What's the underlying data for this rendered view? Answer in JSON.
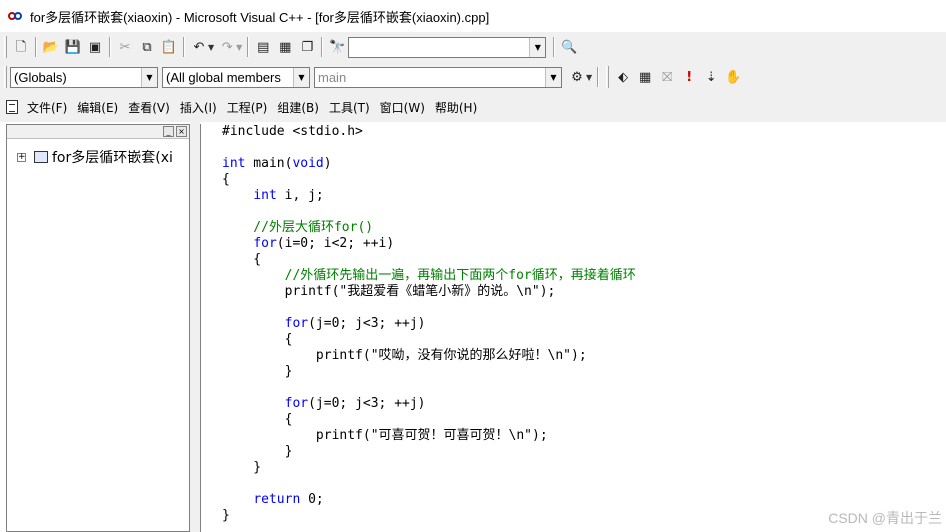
{
  "window": {
    "title": "for多层循环嵌套(xiaoxin) - Microsoft Visual C++ - [for多层循环嵌套(xiaoxin).cpp]"
  },
  "toolbar": {
    "find_value": "",
    "icons": [
      "new-file-icon",
      "open-folder-icon",
      "save-icon",
      "save-all-icon",
      "cut-icon",
      "copy-icon",
      "paste-icon",
      "undo-icon",
      "redo-icon",
      "workspace-icon",
      "output-icon",
      "window-list-icon",
      "find-in-files-icon",
      "find-icon"
    ]
  },
  "wizardbar": {
    "class_combo": "(Globals)",
    "filter_combo": "(All global members",
    "member_combo": "main",
    "build_icons": [
      "compile-icon",
      "build-icon",
      "stop-build-icon",
      "execute-icon",
      "go-icon",
      "breakpoint-icon"
    ]
  },
  "menu": {
    "items": [
      "文件(F)",
      "编辑(E)",
      "查看(V)",
      "插入(I)",
      "工程(P)",
      "组建(B)",
      "工具(T)",
      "窗口(W)",
      "帮助(H)"
    ]
  },
  "workspace": {
    "tree_item": "for多层循环嵌套(xi"
  },
  "editor": {
    "lines": [
      [
        {
          "t": "#include <stdio.h>",
          "c": ""
        }
      ],
      [],
      [
        {
          "t": "int",
          "c": "kw"
        },
        {
          "t": " main(",
          "c": ""
        },
        {
          "t": "void",
          "c": "kw"
        },
        {
          "t": ")",
          "c": ""
        }
      ],
      [
        {
          "t": "{",
          "c": ""
        }
      ],
      [
        {
          "t": "    ",
          "c": ""
        },
        {
          "t": "int",
          "c": "kw"
        },
        {
          "t": " i, j;",
          "c": ""
        }
      ],
      [],
      [
        {
          "t": "    //外层大循环for()",
          "c": "cm"
        }
      ],
      [
        {
          "t": "    ",
          "c": ""
        },
        {
          "t": "for",
          "c": "kw"
        },
        {
          "t": "(i=0; i<2; ++i)",
          "c": ""
        }
      ],
      [
        {
          "t": "    {",
          "c": ""
        }
      ],
      [
        {
          "t": "        //外循环先输出一遍，再输出下面两个for循环，再接着循环",
          "c": "cm"
        }
      ],
      [
        {
          "t": "        printf(\"我超爱看《蜡笔小新》的说。\\n\");",
          "c": ""
        }
      ],
      [],
      [
        {
          "t": "        ",
          "c": ""
        },
        {
          "t": "for",
          "c": "kw"
        },
        {
          "t": "(j=0; j<3; ++j)",
          "c": ""
        }
      ],
      [
        {
          "t": "        {",
          "c": ""
        }
      ],
      [
        {
          "t": "            printf(\"哎呦，没有你说的那么好啦！\\n\");",
          "c": ""
        }
      ],
      [
        {
          "t": "        }",
          "c": ""
        }
      ],
      [],
      [
        {
          "t": "        ",
          "c": ""
        },
        {
          "t": "for",
          "c": "kw"
        },
        {
          "t": "(j=0; j<3; ++j)",
          "c": ""
        }
      ],
      [
        {
          "t": "        {",
          "c": ""
        }
      ],
      [
        {
          "t": "            printf(\"可喜可贺！可喜可贺！\\n\");",
          "c": ""
        }
      ],
      [
        {
          "t": "        }",
          "c": ""
        }
      ],
      [
        {
          "t": "    }",
          "c": ""
        }
      ],
      [],
      [
        {
          "t": "    ",
          "c": ""
        },
        {
          "t": "return",
          "c": "kw"
        },
        {
          "t": " 0;",
          "c": ""
        }
      ],
      [
        {
          "t": "}",
          "c": ""
        }
      ]
    ]
  },
  "watermark": "CSDN @青出于兰",
  "colors": {
    "keyword": "#0000ff",
    "comment": "#008000",
    "chrome": "#f0f0f0"
  }
}
